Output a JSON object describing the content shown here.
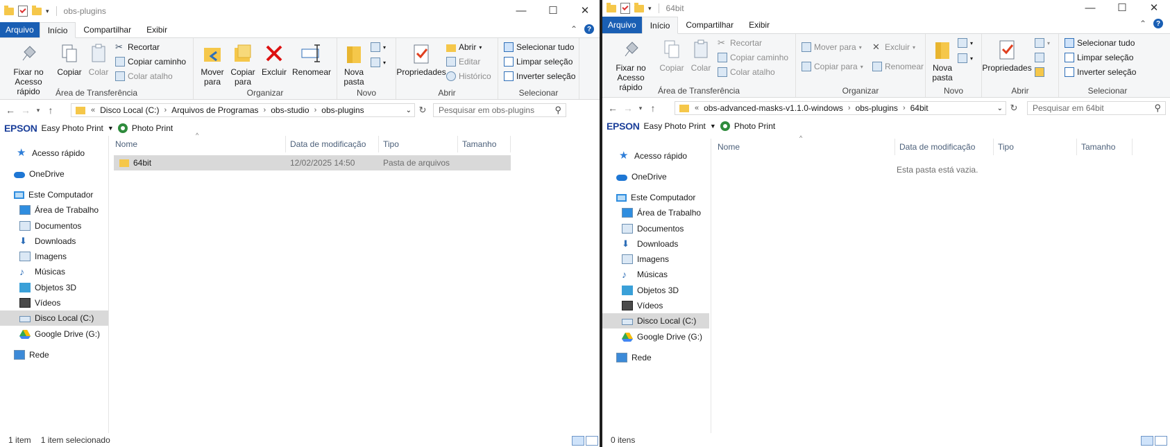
{
  "left": {
    "title": "obs-plugins",
    "ribbon_tabs": [
      "Arquivo",
      "Início",
      "Compartilhar",
      "Exibir"
    ],
    "ribbon": {
      "clipboard": {
        "pin": "Fixar no Acesso rápido",
        "copy": "Copiar",
        "paste": "Colar",
        "cut": "Recortar",
        "copy_path": "Copiar caminho",
        "paste_shortcut": "Colar atalho",
        "label": "Área de Transferência"
      },
      "organize": {
        "move": "Mover para",
        "copy_to": "Copiar para",
        "delete": "Excluir",
        "rename": "Renomear",
        "label": "Organizar"
      },
      "new": {
        "new_folder": "Nova pasta",
        "label": "Novo"
      },
      "open": {
        "properties": "Propriedades",
        "open": "Abrir",
        "edit": "Editar",
        "history": "Histórico",
        "label": "Abrir"
      },
      "select": {
        "select_all": "Selecionar tudo",
        "clear": "Limpar seleção",
        "invert": "Inverter seleção",
        "label": "Selecionar"
      }
    },
    "breadcrumb": [
      "Disco Local (C:)",
      "Arquivos de Programas",
      "obs-studio",
      "obs-plugins"
    ],
    "search_placeholder": "Pesquisar em obs-plugins",
    "columns": [
      "Nome",
      "Data de modificação",
      "Tipo",
      "Tamanho"
    ],
    "rows": [
      {
        "name": "64bit",
        "date": "12/02/2025 14:50",
        "type": "Pasta de arquivos",
        "size": ""
      }
    ],
    "status": {
      "count": "1 item",
      "selected": "1 item selecionado"
    }
  },
  "right": {
    "title": "64bit",
    "ribbon_tabs": [
      "Arquivo",
      "Início",
      "Compartilhar",
      "Exibir"
    ],
    "ribbon": {
      "clipboard": {
        "pin": "Fixar no Acesso rápido",
        "copy": "Copiar",
        "paste": "Colar",
        "cut": "Recortar",
        "copy_path": "Copiar caminho",
        "paste_shortcut": "Colar atalho",
        "label": "Área de Transferência"
      },
      "organize": {
        "move": "Mover para",
        "copy_to": "Copiar para",
        "delete": "Excluir",
        "rename": "Renomear",
        "label": "Organizar"
      },
      "new": {
        "new_folder": "Nova pasta",
        "label": "Novo"
      },
      "open": {
        "properties": "Propriedades",
        "label": "Abrir"
      },
      "select": {
        "select_all": "Selecionar tudo",
        "clear": "Limpar seleção",
        "invert": "Inverter seleção",
        "label": "Selecionar"
      }
    },
    "breadcrumb": [
      "obs-advanced-masks-v1.1.0-windows",
      "obs-plugins",
      "64bit"
    ],
    "search_placeholder": "Pesquisar em 64bit",
    "columns": [
      "Nome",
      "Data de modificação",
      "Tipo",
      "Tamanho"
    ],
    "empty_message": "Esta pasta está vazia.",
    "status": {
      "count": "0 itens"
    }
  },
  "epson": {
    "brand": "EPSON",
    "easy_photo_print": "Easy Photo Print",
    "photo_print": "Photo Print"
  },
  "nav_items": [
    "Acesso rápido",
    "OneDrive",
    "Este Computador",
    "Área de Trabalho",
    "Documentos",
    "Downloads",
    "Imagens",
    "Músicas",
    "Objetos 3D",
    "Vídeos",
    "Disco Local (C:)",
    "Google Drive (G:)",
    "Rede"
  ],
  "nav_icons": [
    "star-icon",
    "cloud-icon",
    "computer-icon",
    "desktop-icon",
    "documents-icon",
    "downloads-icon",
    "pictures-icon",
    "music-icon",
    "3d-objects-icon",
    "videos-icon",
    "drive-icon",
    "google-drive-icon",
    "network-icon"
  ],
  "colors": {
    "accent": "#1a5fb4",
    "selection": "#d9d9d9",
    "folder": "#f5c74a"
  }
}
